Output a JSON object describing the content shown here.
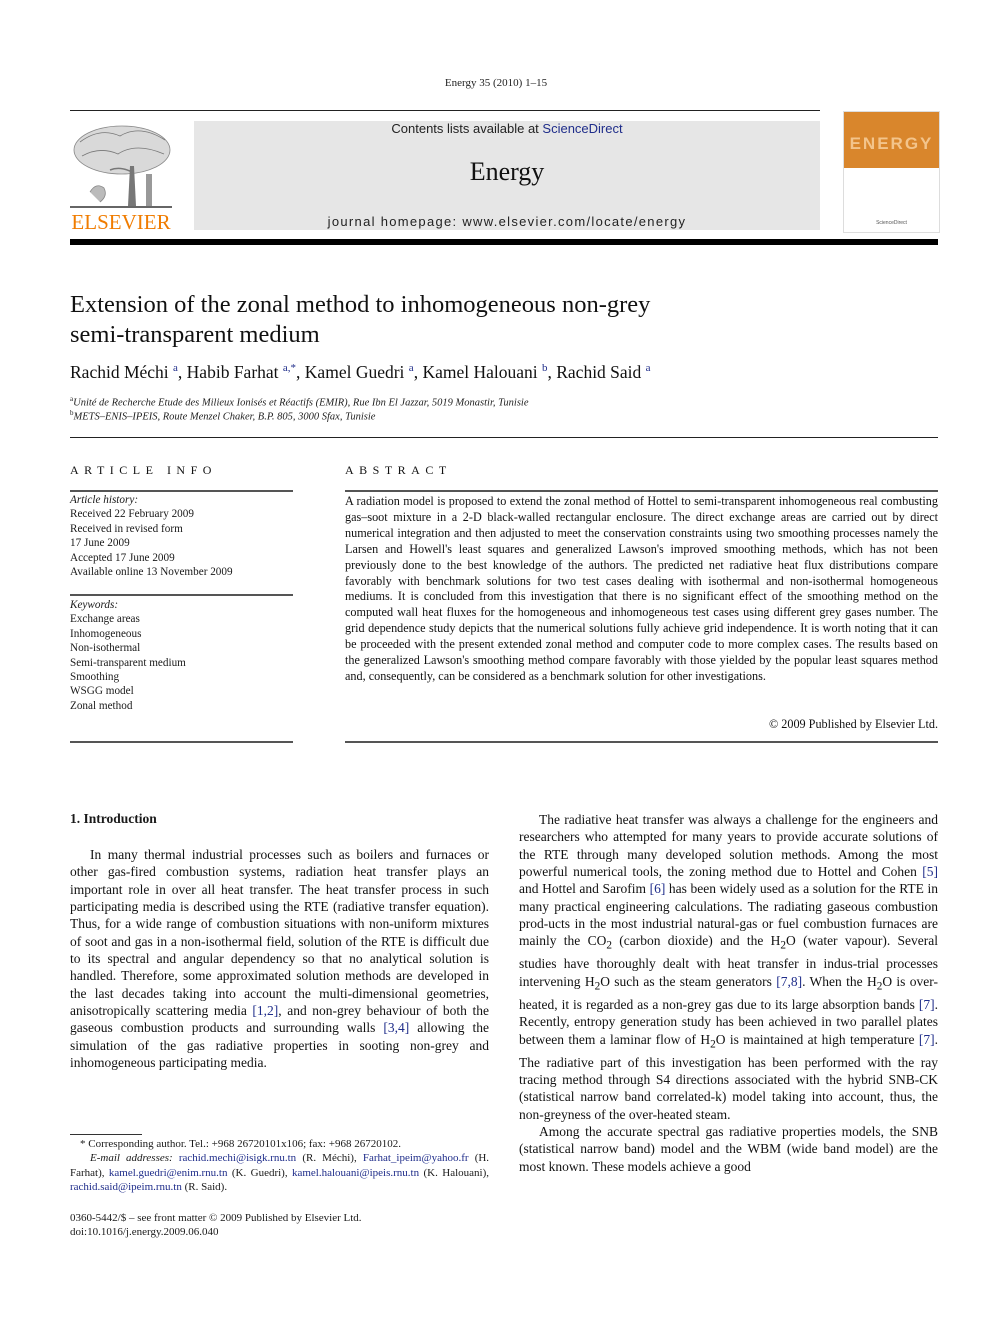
{
  "running_head": "Energy 35 (2010) 1–15",
  "banner": {
    "contents_prefix": "Contents lists available at ",
    "contents_link": "ScienceDirect",
    "journal_name": "Energy",
    "homepage": "journal homepage: www.elsevier.com/locate/energy"
  },
  "publisher_logo": {
    "name": "ELSEVIER",
    "icon": "elsevier-tree-icon",
    "color": "#f07c00"
  },
  "cover": {
    "title": "ENERGY",
    "footer": "ScienceDirect",
    "color": "#d9862c"
  },
  "article": {
    "title_line1": "Extension of the zonal method to inhomogeneous non-grey",
    "title_line2": "semi-transparent medium",
    "authors": [
      {
        "name": "Rachid Méchi",
        "sup": "a"
      },
      {
        "name": "Habib Farhat",
        "sup": "a,*"
      },
      {
        "name": "Kamel Guedri",
        "sup": "a"
      },
      {
        "name": "Kamel Halouani",
        "sup": "b"
      },
      {
        "name": "Rachid Said",
        "sup": "a"
      }
    ],
    "affiliations": [
      {
        "sup": "a",
        "text": "Unité de Recherche Etude des Milieux Ionisés et Réactifs (EMIR), Rue Ibn El Jazzar, 5019 Monastir, Tunisie"
      },
      {
        "sup": "b",
        "text": "METS–ENIS–IPEIS, Route Menzel Chaker, B.P. 805, 3000 Sfax, Tunisie"
      }
    ]
  },
  "article_info": {
    "heading": "ARTICLE INFO",
    "history_label": "Article history:",
    "history": [
      "Received 22 February 2009",
      "Received in revised form",
      "17 June 2009",
      "Accepted 17 June 2009",
      "Available online 13 November 2009"
    ],
    "keywords_label": "Keywords:",
    "keywords": [
      "Exchange areas",
      "Inhomogeneous",
      "Non-isothermal",
      "Semi-transparent medium",
      "Smoothing",
      "WSGG model",
      "Zonal method"
    ]
  },
  "abstract": {
    "heading": "ABSTRACT",
    "text": "A radiation model is proposed to extend the zonal method of Hottel to semi-transparent inhomogeneous real combusting gas–soot mixture in a 2-D black-walled rectangular enclosure. The direct exchange areas are carried out by direct numerical integration and then adjusted to meet the conservation constraints using two smoothing processes namely the Larsen and Howell's least squares and generalized Lawson's improved smoothing methods, which has not been previously done to the best knowledge of the authors. The predicted net radiative heat flux distributions compare favorably with benchmark solutions for two test cases dealing with isothermal and non-isothermal homogeneous mediums. It is concluded from this investigation that there is no significant effect of the smoothing method on the computed wall heat fluxes for the homogeneous and inhomogeneous test cases using different grey gases number. The grid dependence study depicts that the numerical solutions fully achieve grid independence. It is worth noting that it can be proceeded with the present extended zonal method and computer code to more complex cases. The results based on the generalized Lawson's smoothing method compare favorably with those yielded by the popular least squares method and, consequently, can be considered as a benchmark solution for other investigations.",
    "copyright": "© 2009 Published by Elsevier Ltd."
  },
  "introduction": {
    "heading": "1.  Introduction",
    "left_p1": [
      "In many thermal industrial processes such as boilers and furnaces or other gas-fired combustion systems, radiation heat transfer plays an important role in over all heat transfer. The heat transfer process in such participating media is described using the RTE (radiative transfer equation). Thus, for a wide range of combustion situations with non-uniform mixtures of soot and gas in a non-isothermal field, solution of the RTE is difficult due to its spectral and angular dependency so that no analytical solution is handled. Therefore, some approximated solution methods are developed in the last decades taking into account the multi-dimensional geometries, anisotropically scattering media ",
      "[1,2]",
      ", and non-grey behaviour of both the gaseous combustion products and surrounding walls ",
      "[3,4]",
      " allowing the simulation of the gas radiative properties in sooting non-grey and inhomogeneous participating media."
    ],
    "right_p1": {
      "a": "The radiative heat transfer was always a challenge for the engineers and researchers who attempted for many years to provide accurate solutions of the RTE through many developed solution methods. Among the most powerful numerical tools, the zoning method due to Hottel and Cohen ",
      "ref5": "[5]",
      "b": " and Hottel and Sarofim ",
      "ref6": "[6]",
      "c": " has been widely used as a solution for the RTE in many practical engineering calculations. The radiating gaseous combustion prod-ucts in the most industrial natural-gas or fuel combustion furnaces are mainly the CO",
      "sub2": "2",
      "d": " (carbon dioxide) and the H",
      "e": "O (water vapour). Several studies have thoroughly dealt with heat transfer in indus-trial processes intervening H",
      "f": "O such as the steam generators ",
      "ref78": "[7,8]",
      "g": ". When the H",
      "h": "O is over-heated, it is regarded as a non-grey gas due to its large absorption bands ",
      "ref7": "[7]",
      "i": ". Recently, entropy generation study has been achieved in two parallel plates between them a laminar flow of H",
      "j": "O is maintained at high temperature ",
      "k": ". The radiative part of this investigation has been performed with the ray tracing method through S4 directions associated with the hybrid SNB-CK (statistical narrow band correlated-k) model taking into account, thus, the non-greyness of the over-heated steam."
    },
    "right_p2": "Among the accurate spectral gas radiative properties models, the SNB (statistical narrow band) model and the WBM (wide band model) are the most known. These models achieve a good"
  },
  "footnotes": {
    "corresponding": "* Corresponding author. Tel.: +968 26720101x106; fax: +968 26720102.",
    "email_label": "E-mail addresses:",
    "emails": [
      {
        "address": "rachid.mechi@isigk.rnu.tn",
        "who": "(R. Méchi)"
      },
      {
        "address": "Farhat_ipeim@yahoo.fr",
        "who": "(H. Farhat)"
      },
      {
        "address": "kamel.guedri@enim.rnu.tn",
        "who": "(K. Guedri)"
      },
      {
        "address": "kamel.halouani@ipeis.rnu.tn",
        "who": "(K. Halouani)"
      },
      {
        "address": "rachid.said@ipeim.rnu.tn",
        "who": "(R. Said)."
      }
    ],
    "front_matter": "0360-5442/$ – see front matter © 2009 Published by Elsevier Ltd.",
    "doi": "doi:10.1016/j.energy.2009.06.040"
  },
  "colors": {
    "link": "#1f2d8a",
    "elsevier_orange": "#f07c00",
    "banner_bg": "#e6e6e6"
  }
}
